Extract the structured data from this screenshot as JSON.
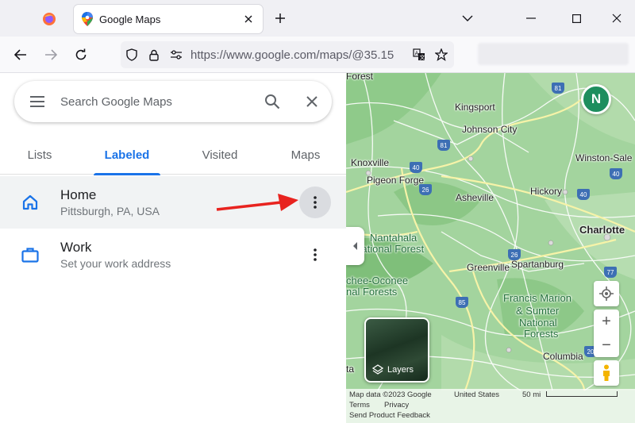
{
  "browser": {
    "tab_title": "Google Maps",
    "url": "https://www.google.com/maps/@35.15"
  },
  "search": {
    "placeholder": "Search Google Maps"
  },
  "tabs": [
    "Lists",
    "Labeled",
    "Visited",
    "Maps"
  ],
  "active_tab": "Labeled",
  "places": [
    {
      "name": "Home",
      "detail": "Pittsburgh, PA, USA",
      "icon": "home-icon"
    },
    {
      "name": "Work",
      "detail": "Set your work address",
      "icon": "briefcase-icon"
    }
  ],
  "map": {
    "labels": {
      "forest": "Forest",
      "kingsport": "Kingsport",
      "johnson_city": "Johnson City",
      "knoxville": "Knoxville",
      "winston_salem": "Winston-Sale",
      "pigeon_forge": "Pigeon Forge",
      "asheville": "Asheville",
      "hickory": "Hickory",
      "nantahala": "Nantahala",
      "national_forest": "National Forest",
      "charlotte": "Charlotte",
      "spartanburg": "Spartanburg",
      "greenville": "Greenville",
      "chee_oconee": "chee-Oconee",
      "nal_forests": "nal Forests",
      "francis_marion": "Francis Marion",
      "sumter": "& Sumter",
      "national": "National",
      "forests": "Forests",
      "columbia": "Columbia",
      "ta": "ta"
    },
    "shields": [
      "81",
      "81",
      "40",
      "40",
      "26",
      "40",
      "26",
      "85",
      "20",
      "77"
    ],
    "compass": "N",
    "layers_label": "Layers",
    "attribution": {
      "data": "Map data ©2023 Google",
      "country": "United States",
      "scale": "50 mi",
      "terms": "Terms",
      "privacy": "Privacy",
      "feedback": "Send Product Feedback"
    }
  },
  "colors": {
    "accent": "#1a73e8",
    "map_green": "#9fd39a",
    "arrow": "#e8231f"
  }
}
